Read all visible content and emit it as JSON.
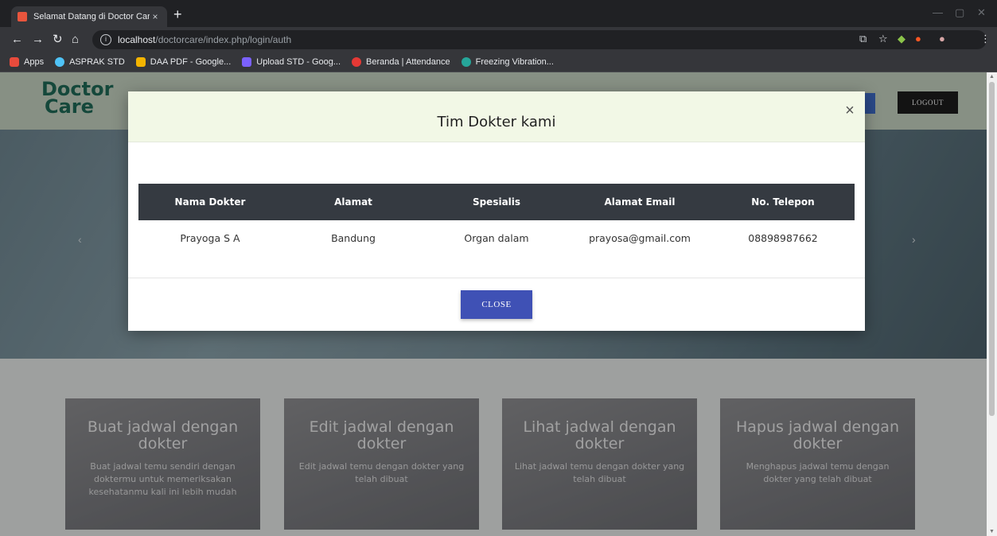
{
  "browser": {
    "tab_title": "Selamat Datang di Doctor Care",
    "tab_close": "×",
    "new_tab": "+",
    "url_host": "localhost",
    "url_path": "/doctorcare/index.php/login/auth",
    "bookmarks": [
      {
        "label": "Apps",
        "color": "#e84b3c"
      },
      {
        "label": "ASPRAK STD",
        "color": "#4fc3f7"
      },
      {
        "label": "DAA PDF - Google...",
        "color": "#f4b400"
      },
      {
        "label": "Upload STD - Goog...",
        "color": "#7b61ff"
      },
      {
        "label": "Beranda | Attendance",
        "color": "#e53935"
      },
      {
        "label": "Freezing Vibration...",
        "color": "#26a69a"
      }
    ]
  },
  "navbar": {
    "logo_line1": "Doctor",
    "logo_line2": "Care",
    "logout_label": "LOGOUT"
  },
  "hero": {
    "prev": "‹",
    "next": "›"
  },
  "features": [
    {
      "title": "Buat jadwal dengan dokter",
      "desc": "Buat jadwal temu sendiri dengan doktermu untuk memeriksakan kesehatanmu kali ini lebih mudah"
    },
    {
      "title": "Edit jadwal dengan dokter",
      "desc": "Edit jadwal temu dengan dokter yang telah dibuat"
    },
    {
      "title": "Lihat jadwal dengan dokter",
      "desc": "Lihat jadwal temu dengan dokter yang telah dibuat"
    },
    {
      "title": "Hapus jadwal dengan dokter",
      "desc": "Menghapus jadwal temu dengan dokter yang telah dibuat"
    }
  ],
  "modal": {
    "title": "Tim Dokter kami",
    "close_icon": "×",
    "close_label": "CLOSE",
    "columns": [
      "Nama Dokter",
      "Alamat",
      "Spesialis",
      "Alamat Email",
      "No. Telepon"
    ],
    "rows": [
      [
        "Prayoga S A",
        "Bandung",
        "Organ dalam",
        "prayosa@gmail.com",
        "08898987662"
      ]
    ]
  },
  "colors": {
    "modal_header": "#f2f8e6",
    "table_header": "#353a41",
    "close_button": "#3f51b5",
    "logo": "#1f6b58"
  }
}
